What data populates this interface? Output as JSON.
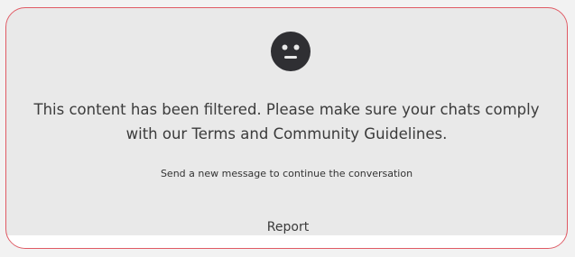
{
  "filtered_notice": {
    "icon": "neutral-face-icon",
    "message_line1": "This content has been filtered. Please make sure your chats comply",
    "message_line2": "with our Terms and Community Guidelines.",
    "hint": "Send a new message to continue the conversation",
    "report_label": "Report"
  },
  "colors": {
    "border": "#e05a64",
    "panel_background": "#e9e9e9",
    "icon_fill": "#2f2f33",
    "text": "#3b3b3b"
  }
}
